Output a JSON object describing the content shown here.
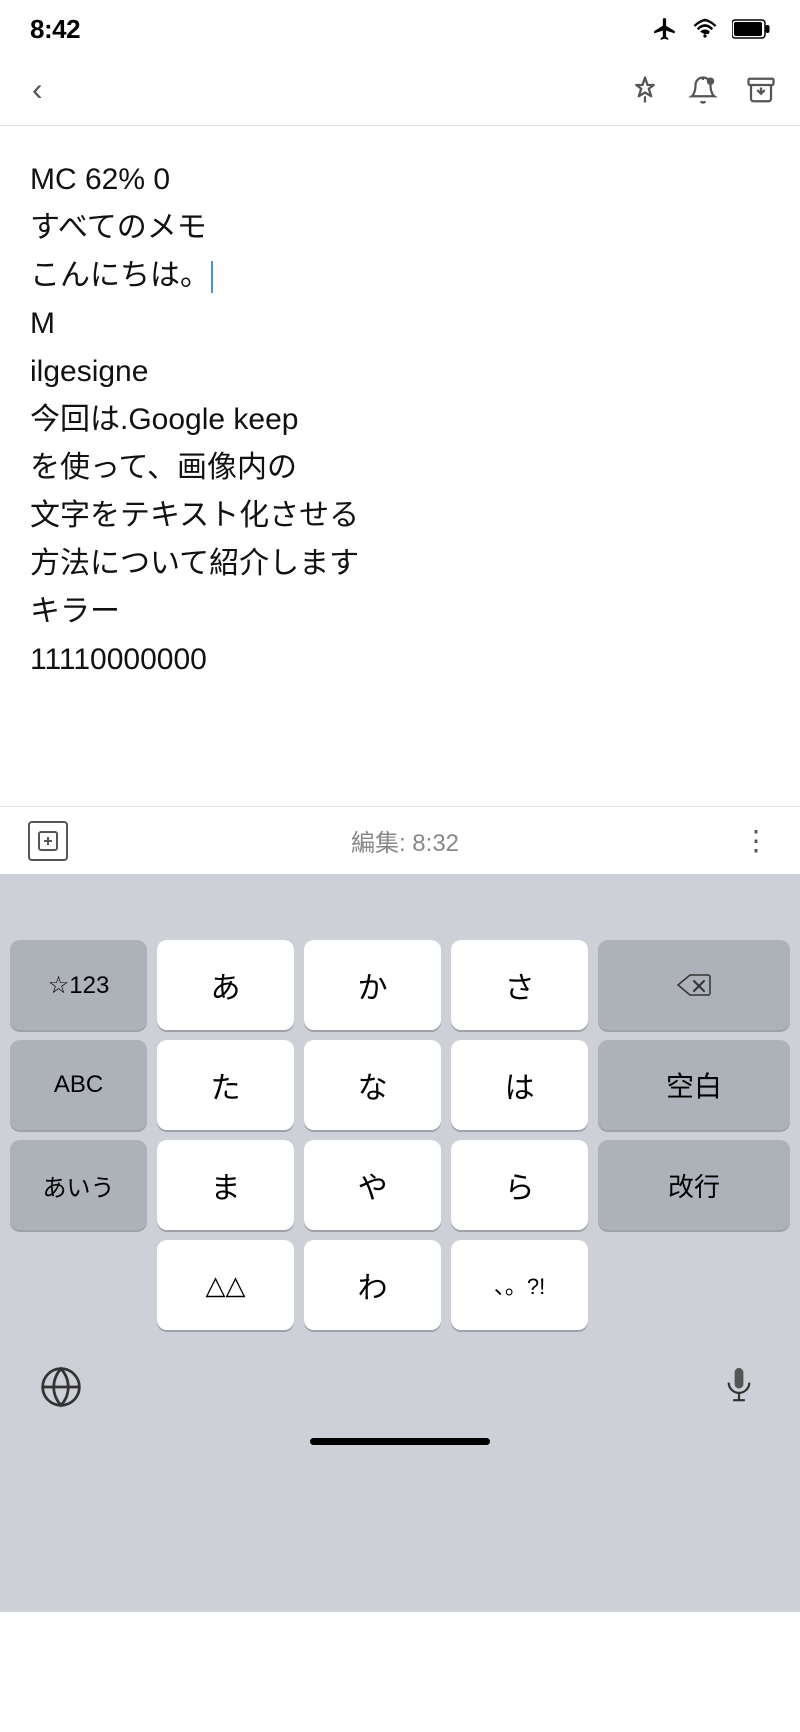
{
  "statusBar": {
    "time": "8:42",
    "hasLocation": true
  },
  "navBar": {
    "backLabel": "‹",
    "pinIconLabel": "pin-icon",
    "bellIconLabel": "bell-alert-icon",
    "archiveIconLabel": "archive-icon"
  },
  "note": {
    "content": "MC 62% 0\nすべてのメモ\nこんにちは。\nM\nilgesigne\n今回は.Google keep\nを使って、画像内の\n文字をテキスト化させる\n方法について紹介します\nキラー\n11110000000"
  },
  "bottomBar": {
    "editTime": "編集: 8:32"
  },
  "keyboard": {
    "row1": [
      "☆123",
      "あ",
      "か",
      "さ",
      "⌫"
    ],
    "row2": [
      "ABC",
      "た",
      "な",
      "は",
      "空白"
    ],
    "row3top": [
      "あいう",
      "ま",
      "や",
      "ら",
      "改行"
    ],
    "row3bot": [
      "",
      "△△",
      "わ",
      "、。?!",
      ""
    ],
    "globeLabel": "globe",
    "micLabel": "microphone"
  }
}
